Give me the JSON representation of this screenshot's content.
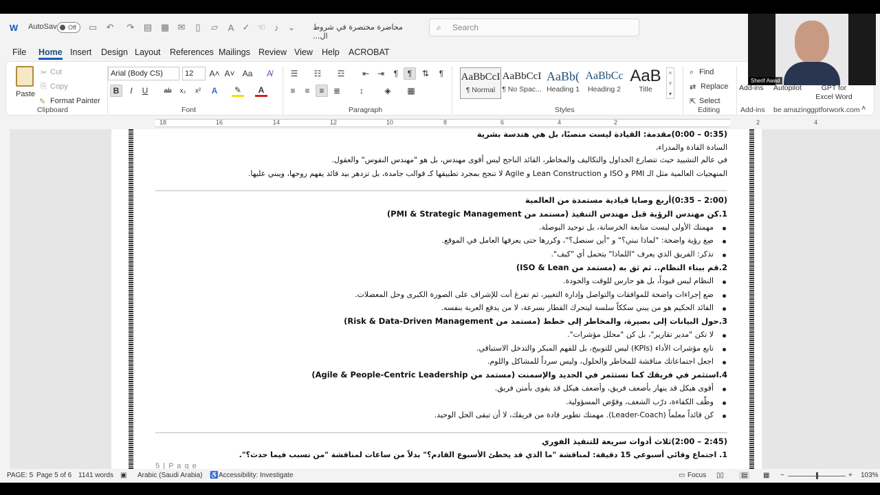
{
  "titlebar": {
    "autosave_label": "AutoSave",
    "toggle_state": "Off",
    "doc_title": "محاضرة مختصرة في شروط ال...",
    "search_placeholder": "Search"
  },
  "menu": [
    "File",
    "Home",
    "Insert",
    "Design",
    "Layout",
    "References",
    "Mailings",
    "Review",
    "View",
    "Help",
    "ACROBAT"
  ],
  "ribbon": {
    "clipboard": {
      "paste": "Paste",
      "cut": "Cut",
      "copy": "Copy",
      "format_painter": "Format Painter",
      "label": "Clipboard"
    },
    "font": {
      "family": "Arial (Body CS)",
      "size": "12",
      "label": "Font"
    },
    "paragraph": {
      "label": "Paragraph"
    },
    "styles": {
      "items": [
        {
          "preview": "AaBbCcI",
          "name": "¶ Normal"
        },
        {
          "preview": "AaBbCcI",
          "name": "¶ No Spac..."
        },
        {
          "preview": "AaBb(",
          "name": "Heading 1"
        },
        {
          "preview": "AaBbCc",
          "name": "Heading 2"
        },
        {
          "preview": "AaB",
          "name": "Title"
        }
      ],
      "label": "Styles"
    },
    "editing": {
      "find": "Find",
      "replace": "Replace",
      "select": "Select",
      "label": "Editing"
    },
    "addins": {
      "label": "Add-ins",
      "items": [
        "Add-ins",
        "Autopilot",
        "GPT for Excel Word"
      ],
      "captions": [
        "be amazing",
        "gptforwork.com"
      ]
    }
  },
  "ruler": {
    "numbers": [
      "18",
      "16",
      "14",
      "12",
      "10",
      "8",
      "6",
      "4",
      "2",
      "2",
      "4"
    ]
  },
  "video": {
    "name": "Sherif Awad"
  },
  "document": {
    "lines": [
      {
        "text": "(0:35 – 0:00)مقدمة: القيادة ليست منصبًا، بل هي هندسة بشرية",
        "kind": "h"
      },
      {
        "text": "السادة القادة والمدراء،",
        "kind": "p"
      },
      {
        "text": "في عالم التشييد حيث تتصارع الجداول والتكاليف والمخاطر، القائد الناجح ليس أقوى مهندس، بل هو \"مهندس النفوس\" والعقول.",
        "kind": "p"
      },
      {
        "text": "المنهجيات العالمية مثل الـ PMI و ISO و Lean Construction و Agile لا تنجح بمجرد تطبيقها كـ قوالب جامدة، بل تزدهر بيد قائد يفهم روحها، ويبني عليها.",
        "kind": "p"
      },
      {
        "text": "(2:00 – 0:35)أربع وصايا قيادية مستمدة من العالمية",
        "kind": "h"
      },
      {
        "text": "1.كن مهندس الرؤية قبل مهندس التنفيذ (مستمد من PMI & Strategic Management)",
        "kind": "h"
      },
      {
        "text": "مهمتك الأولى ليست متابعة الخرسانة، بل توحيد البوصلة.",
        "kind": "bul"
      },
      {
        "text": "صِغ رؤية واضحة: \"لماذا نبني؟\" و \"أين سنصل؟\"، وكررها حتى يعرفها العامل في الموقع.",
        "kind": "bul"
      },
      {
        "text": "تذكر: الفريق الذي يعرف \"اللماذا\" يتحمل أي \"كيف\".",
        "kind": "bul"
      },
      {
        "text": "2.قم ببناء النظام.. ثم ثق به (مستمد من ISO & Lean)",
        "kind": "h"
      },
      {
        "text": "النظام ليس قيوداً، بل هو حارس للوقت والجودة.",
        "kind": "bul"
      },
      {
        "text": "ضع إجراءات واضحة للموافقات والتواصل وإدارة التغيير، ثم تفرغ أنت للإشراف على الصورة الكبرى وحل المعضلات.",
        "kind": "bul"
      },
      {
        "text": "القائد الحكيم هو من يبني سككاً سلسة ليتحرك القطار بسرعة، لا من يدفع العربة بنفسه.",
        "kind": "bul"
      },
      {
        "text": "3.حول البيانات إلى بصيرة، والمخاطر إلى خطط (مستمد من Risk & Data-Driven Management)",
        "kind": "h"
      },
      {
        "text": "لا تكن \"مدير تقارير\"، بل كن \"محلل مؤشرات\".",
        "kind": "bul"
      },
      {
        "text": "تابع مؤشرات الأداء (KPIs) ليس للتوبيخ، بل للفهم المبكر والتدخل الاستباقي.",
        "kind": "bul"
      },
      {
        "text": "اجعل اجتماعاتك مناقشة للمخاطر والحلول، وليس سرداً للمشاكل واللوم.",
        "kind": "bul"
      },
      {
        "text": "4.استثمر في فريقك كما تستثمر في الحديد والإسمنت (مستمد من Agile & People-Centric Leadership)",
        "kind": "h"
      },
      {
        "text": "أقوى هيكل قد ينهار بأضعف فريق، وأضعف هيكل قد يقوى بأمتن فريق.",
        "kind": "bul"
      },
      {
        "text": "وظّف الكفاءة، درّب الشغف، وفوّض المسؤولية.",
        "kind": "bul"
      },
      {
        "text": "كن قائداً معلماً (Leader-Coach). مهمتك تطوير قادة من فريقك، لا أن تبقى الحل الوحيد.",
        "kind": "bul"
      },
      {
        "text": "(2:45 – 2:00)ثلاث أدوات سريعة للتنفيذ الفوري",
        "kind": "h"
      },
      {
        "text": "1.  اجتماع وقائي أسبوعي 15 دقيقة: لمناقشة \"ما الذي قد يخطئ الأسبوع القادم؟\" بدلاً من ساعات لمناقشة \"من تسبب فيما حدث؟\".",
        "kind": "p"
      }
    ],
    "footer_page": "5 | P a g e"
  },
  "status": {
    "page": "PAGE: 5",
    "page_of": "Page 5 of 6",
    "words": "1141 words",
    "language": "Arabic (Saudi Arabia)",
    "accessibility": "Accessibility: Investigate",
    "focus": "Focus",
    "zoom": "103%"
  }
}
